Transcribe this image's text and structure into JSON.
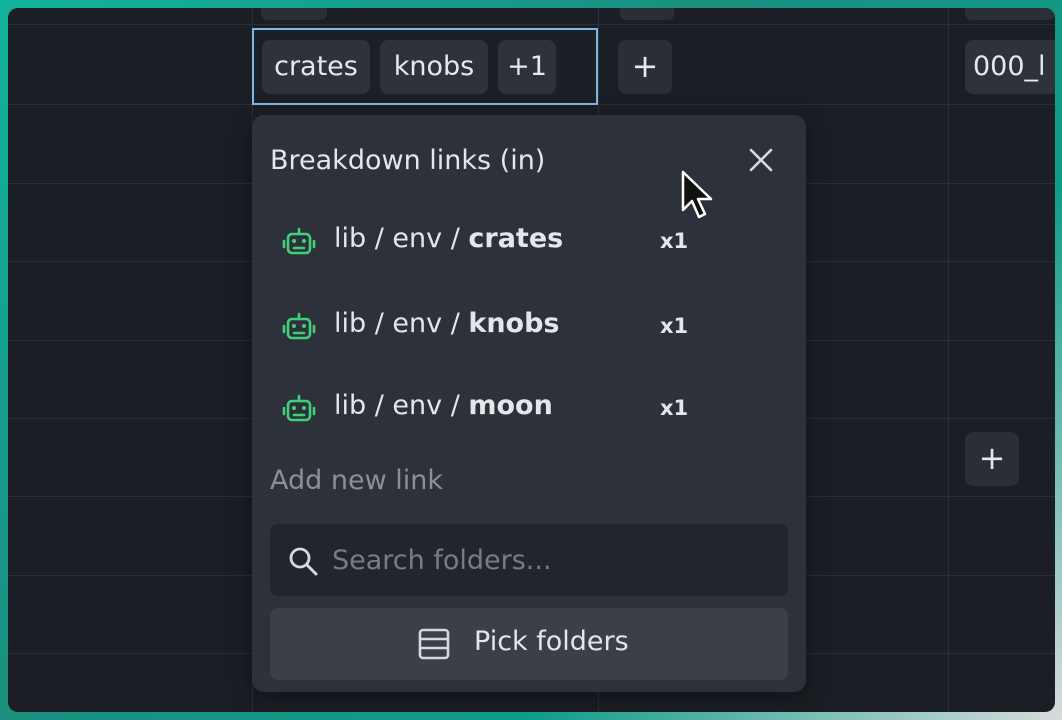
{
  "cell": {
    "chips": [
      "crates",
      "knobs",
      "+1"
    ],
    "add_symbol": "+",
    "truncated_value": "000_l"
  },
  "popover": {
    "title": "Breakdown links (in)",
    "links": [
      {
        "prefix": "lib / env / ",
        "name": "crates",
        "count": "x1"
      },
      {
        "prefix": "lib / env / ",
        "name": "knobs",
        "count": "x1"
      },
      {
        "prefix": "lib / env / ",
        "name": "moon",
        "count": "x1"
      }
    ],
    "add_new_label": "Add new link",
    "search_placeholder": "Search folders...",
    "pick_label": "Pick folders"
  },
  "colors": {
    "accent_border": "#7fb6e6",
    "robot_icon": "#3fd07a"
  },
  "icons": {
    "link_icon": "robot-icon",
    "close": "close-icon",
    "search": "search-icon",
    "pick": "list-icon"
  }
}
